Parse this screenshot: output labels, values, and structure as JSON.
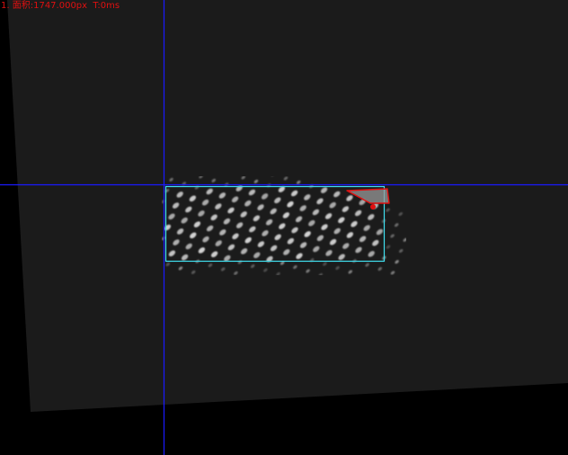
{
  "overlay": {
    "result_text": "1. 面积:1747.000px  T:0ms",
    "text_color": "#e01010"
  },
  "colors": {
    "background": "#000000",
    "sample_surface": "#1b1b1b",
    "crosshair": "#1a1aff",
    "roi_box": "#40e0f0",
    "defect_region": "#e01010",
    "dot_pattern": "#d8d8d8"
  },
  "scene": {
    "crosshair_label": "crosshair",
    "roi_label": "inspection-roi",
    "defect_label": "defect-region"
  }
}
